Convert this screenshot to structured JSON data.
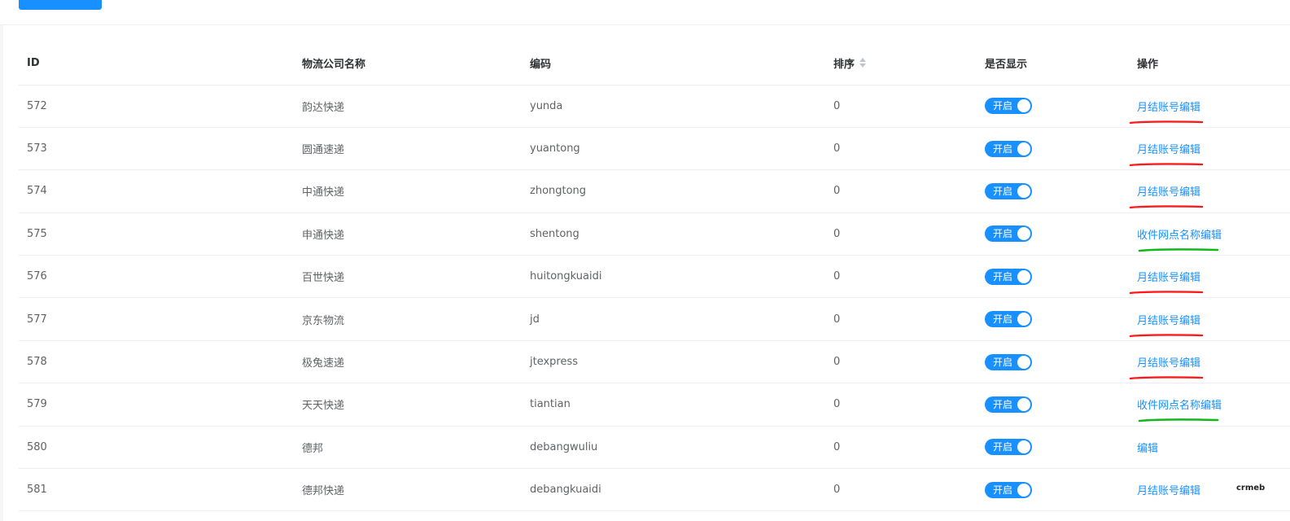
{
  "table": {
    "headers": {
      "id": "ID",
      "name": "物流公司名称",
      "code": "编码",
      "sort": "排序",
      "show": "是否显示",
      "operation": "操作"
    },
    "rows": [
      {
        "id": "572",
        "name": "韵达快递",
        "code": "yunda",
        "sort": "0",
        "show_label": "开启",
        "operation": "月结账号编辑",
        "mark_color": "#ff1a1a"
      },
      {
        "id": "573",
        "name": "圆通速递",
        "code": "yuantong",
        "sort": "0",
        "show_label": "开启",
        "operation": "月结账号编辑",
        "mark_color": "#ff1a1a"
      },
      {
        "id": "574",
        "name": "中通快递",
        "code": "zhongtong",
        "sort": "0",
        "show_label": "开启",
        "operation": "月结账号编辑",
        "mark_color": "#ff1a1a"
      },
      {
        "id": "575",
        "name": "申通快递",
        "code": "shentong",
        "sort": "0",
        "show_label": "开启",
        "operation": "收件网点名称编辑",
        "mark_color": "#12b81a"
      },
      {
        "id": "576",
        "name": "百世快递",
        "code": "huitongkuaidi",
        "sort": "0",
        "show_label": "开启",
        "operation": "月结账号编辑",
        "mark_color": "#ff1a1a"
      },
      {
        "id": "577",
        "name": "京东物流",
        "code": "jd",
        "sort": "0",
        "show_label": "开启",
        "operation": "月结账号编辑",
        "mark_color": "#ff1a1a"
      },
      {
        "id": "578",
        "name": "极兔速递",
        "code": "jtexpress",
        "sort": "0",
        "show_label": "开启",
        "operation": "月结账号编辑",
        "mark_color": "#ff1a1a"
      },
      {
        "id": "579",
        "name": "天天快递",
        "code": "tiantian",
        "sort": "0",
        "show_label": "开启",
        "operation": "收件网点名称编辑",
        "mark_color": "#12b81a"
      },
      {
        "id": "580",
        "name": "德邦",
        "code": "debangwuliu",
        "sort": "0",
        "show_label": "开启",
        "operation": "编辑",
        "mark_color": ""
      },
      {
        "id": "581",
        "name": "德邦快递",
        "code": "debangkuaidi",
        "sort": "0",
        "show_label": "开启",
        "operation": "月结账号编辑",
        "mark_color": ""
      }
    ]
  },
  "colors": {
    "primary": "#1890ff",
    "red_mark": "#ff1a1a",
    "green_mark": "#12b81a"
  },
  "icons": {
    "sort": "sort-caret-icon",
    "corner_logo": "crmeb-logo"
  },
  "corner_logo_text": "crmeb"
}
